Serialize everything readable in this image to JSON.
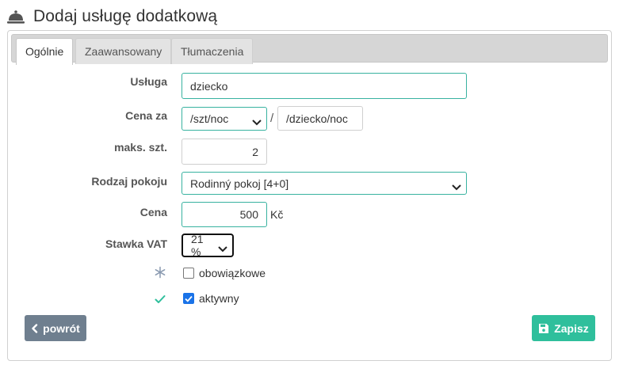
{
  "header": {
    "title": "Dodaj usługę dodatkową",
    "icon": "bell-icon"
  },
  "tabs": [
    {
      "label": "Ogólnie",
      "active": true
    },
    {
      "label": "Zaawansowany",
      "active": false
    },
    {
      "label": "Tłumaczenia",
      "active": false
    }
  ],
  "form": {
    "service": {
      "label": "Usługa",
      "value": "dziecko"
    },
    "price_per": {
      "label": "Cena za",
      "selected": "/szt/noc",
      "separator": "/",
      "value": "/dziecko/noc"
    },
    "max_qty": {
      "label": "maks. szt.",
      "value": "2"
    },
    "room_type": {
      "label": "Rodzaj pokoju",
      "selected": "Rodinný pokoj [4+0]"
    },
    "price": {
      "label": "Cena",
      "value": "500",
      "currency": "Kč"
    },
    "vat": {
      "label": "Stawka VAT",
      "selected": "21 %"
    },
    "mandatory": {
      "label": "obowiązkowe",
      "checked": false
    },
    "active": {
      "label": "aktywny",
      "checked": true
    }
  },
  "buttons": {
    "back": "powrót",
    "save": "Zapisz"
  },
  "colors": {
    "accent": "#2fbf9c",
    "focus": "#38b2a0",
    "back": "#6f7f8f",
    "checkbox": "#1a73e8"
  }
}
